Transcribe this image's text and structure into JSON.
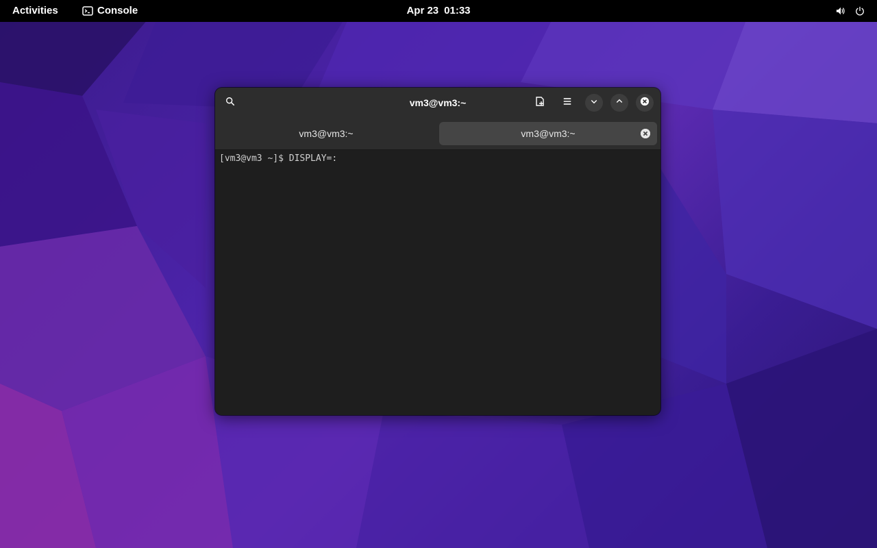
{
  "topbar": {
    "activities_label": "Activities",
    "app_name": "Console",
    "date": "Apr 23",
    "time": "01:33"
  },
  "window": {
    "title": "vm3@vm3:~",
    "tabs": [
      {
        "label": "vm3@vm3:~",
        "active": false
      },
      {
        "label": "vm3@vm3:~",
        "active": true
      }
    ],
    "terminal": {
      "prompt": "[vm3@vm3 ~]$ ",
      "command": "DISPLAY=:"
    }
  },
  "icons": {
    "app": "terminal-icon",
    "volume": "volume-icon",
    "power": "power-icon",
    "search": "search-icon",
    "new_tab": "new-tab-icon",
    "menu": "hamburger-menu-icon",
    "minimize": "chevron-down-icon",
    "maximize": "chevron-up-icon",
    "close": "close-icon"
  },
  "colors": {
    "topbar_bg": "#000000",
    "headerbar_bg": "#2d2d2d",
    "terminal_bg": "#1e1e1e",
    "active_tab_bg": "#454545",
    "wallpaper_primary": "#4b23a8"
  }
}
